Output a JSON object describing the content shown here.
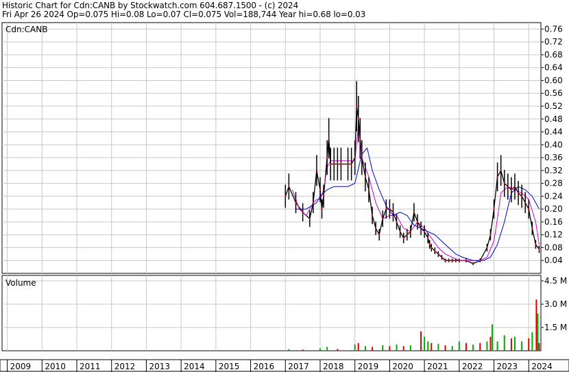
{
  "header": {
    "line1": "Historic Chart for Cdn:CANB by Stockwatch.com 604.687.1500 - (c) 2024",
    "line2": "Fri Apr 26 2024   Op=0.075   Hi=0.08   Lo=0.07   Cl=0.075   Vol=188,744   Year hi=0.68   lo=0.03"
  },
  "chart_data": [
    {
      "type": "line",
      "title": "Cdn:CANB",
      "ylim": [
        0,
        0.78
      ],
      "y_ticks": [
        "0.76",
        "0.72",
        "0.68",
        "0.64",
        "0.60",
        "0.56",
        "0.52",
        "0.48",
        "0.44",
        "0.40",
        "0.36",
        "0.32",
        "0.28",
        "0.24",
        "0.20",
        "0.16",
        "0.12",
        "0.08",
        "0.04"
      ],
      "x_labels": [
        "2009",
        "2010",
        "2011",
        "2012",
        "2013",
        "2014",
        "2015",
        "2016",
        "2017",
        "2018",
        "2019",
        "2020",
        "2021",
        "2022",
        "2023",
        "2024"
      ],
      "grid": true,
      "colors": {
        "price": "#000000",
        "ma_short": "#ff0000",
        "ma_mid": "#cc00cc",
        "ma_long": "#0000cc"
      },
      "series": [
        {
          "role": "price",
          "x": [
            2017.0,
            2017.1,
            2017.3,
            2017.5,
            2017.7,
            2017.8,
            2017.9,
            2018.0,
            2018.05,
            2018.1,
            2018.2,
            2018.25,
            2018.3,
            2018.4,
            2018.5,
            2018.6,
            2018.8,
            2018.9,
            2019.0,
            2019.05,
            2019.1,
            2019.15,
            2019.2,
            2019.3,
            2019.4,
            2019.5,
            2019.6,
            2019.7,
            2019.8,
            2019.9,
            2020.0,
            2020.1,
            2020.2,
            2020.3,
            2020.4,
            2020.5,
            2020.6,
            2020.7,
            2020.8,
            2020.9,
            2021.0,
            2021.1,
            2021.15,
            2021.2,
            2021.3,
            2021.4,
            2021.5,
            2021.6,
            2021.7,
            2021.8,
            2021.9,
            2022.0,
            2022.2,
            2022.4,
            2022.6,
            2022.8,
            2022.9,
            2023.0,
            2023.1,
            2023.2,
            2023.3,
            2023.4,
            2023.5,
            2023.6,
            2023.7,
            2023.8,
            2023.9,
            2024.0,
            2024.1,
            2024.2,
            2024.3
          ],
          "values": [
            0.24,
            0.27,
            0.22,
            0.19,
            0.17,
            0.22,
            0.32,
            0.26,
            0.2,
            0.24,
            0.36,
            0.42,
            0.34,
            0.34,
            0.34,
            0.34,
            0.34,
            0.34,
            0.36,
            0.52,
            0.48,
            0.42,
            0.36,
            0.3,
            0.26,
            0.18,
            0.14,
            0.12,
            0.17,
            0.2,
            0.2,
            0.19,
            0.16,
            0.13,
            0.11,
            0.12,
            0.13,
            0.19,
            0.16,
            0.14,
            0.13,
            0.11,
            0.09,
            0.08,
            0.07,
            0.06,
            0.05,
            0.04,
            0.04,
            0.04,
            0.04,
            0.04,
            0.04,
            0.03,
            0.04,
            0.08,
            0.12,
            0.2,
            0.3,
            0.32,
            0.28,
            0.27,
            0.26,
            0.27,
            0.25,
            0.24,
            0.22,
            0.2,
            0.14,
            0.09,
            0.075
          ]
        },
        {
          "role": "ma_mid",
          "x": [
            2017.2,
            2017.4,
            2017.6,
            2017.8,
            2017.9,
            2018.0,
            2018.1,
            2018.2,
            2018.3,
            2018.5,
            2018.7,
            2018.9,
            2019.0,
            2019.1,
            2019.2,
            2019.4,
            2019.6,
            2019.8,
            2020.0,
            2020.2,
            2020.4,
            2020.6,
            2020.8,
            2021.0,
            2021.2,
            2021.4,
            2021.6,
            2021.8,
            2022.0,
            2022.3,
            2022.6,
            2022.8,
            2023.0,
            2023.1,
            2023.2,
            2023.4,
            2023.6,
            2023.8,
            2024.0,
            2024.2,
            2024.3
          ],
          "values": [
            0.26,
            0.2,
            0.18,
            0.22,
            0.23,
            0.23,
            0.26,
            0.33,
            0.35,
            0.35,
            0.35,
            0.35,
            0.35,
            0.46,
            0.36,
            0.3,
            0.22,
            0.17,
            0.18,
            0.18,
            0.14,
            0.13,
            0.16,
            0.14,
            0.11,
            0.08,
            0.06,
            0.05,
            0.04,
            0.04,
            0.04,
            0.05,
            0.1,
            0.17,
            0.25,
            0.27,
            0.26,
            0.25,
            0.23,
            0.16,
            0.09
          ]
        },
        {
          "role": "ma_long",
          "x": [
            2017.3,
            2017.6,
            2017.9,
            2018.0,
            2018.2,
            2018.4,
            2018.6,
            2018.8,
            2019.0,
            2019.2,
            2019.35,
            2019.5,
            2019.7,
            2019.9,
            2020.1,
            2020.3,
            2020.5,
            2020.7,
            2020.9,
            2021.1,
            2021.3,
            2021.5,
            2021.7,
            2021.9,
            2022.1,
            2022.4,
            2022.7,
            2022.9,
            2023.1,
            2023.3,
            2023.5,
            2023.7,
            2023.9,
            2024.1,
            2024.3
          ],
          "values": [
            0.2,
            0.2,
            0.22,
            0.24,
            0.26,
            0.27,
            0.27,
            0.27,
            0.28,
            0.37,
            0.39,
            0.32,
            0.26,
            0.21,
            0.18,
            0.19,
            0.18,
            0.15,
            0.14,
            0.13,
            0.12,
            0.1,
            0.08,
            0.06,
            0.05,
            0.04,
            0.04,
            0.05,
            0.09,
            0.16,
            0.25,
            0.27,
            0.26,
            0.24,
            0.2
          ]
        }
      ]
    },
    {
      "type": "bar",
      "title": "Volume",
      "ylim": [
        0,
        4.5
      ],
      "y_ticks": [
        "4.5 M",
        "3.0 M",
        "1.5 M"
      ],
      "x_labels": [
        "2009",
        "2010",
        "2011",
        "2012",
        "2013",
        "2014",
        "2015",
        "2016",
        "2017",
        "2018",
        "2019",
        "2020",
        "2021",
        "2022",
        "2023",
        "2024"
      ],
      "grid": true,
      "colors": {
        "up": "#00aa00",
        "down": "#dd0000"
      },
      "bars": [
        {
          "x": 2017.1,
          "v": 0.1,
          "d": "up"
        },
        {
          "x": 2017.5,
          "v": 0.08,
          "d": "down"
        },
        {
          "x": 2018.0,
          "v": 0.15,
          "d": "up"
        },
        {
          "x": 2018.2,
          "v": 0.25,
          "d": "up"
        },
        {
          "x": 2018.5,
          "v": 0.12,
          "d": "down"
        },
        {
          "x": 2019.0,
          "v": 0.4,
          "d": "up"
        },
        {
          "x": 2019.1,
          "v": 0.5,
          "d": "down"
        },
        {
          "x": 2019.3,
          "v": 0.3,
          "d": "up"
        },
        {
          "x": 2019.5,
          "v": 0.25,
          "d": "down"
        },
        {
          "x": 2019.8,
          "v": 0.35,
          "d": "up"
        },
        {
          "x": 2020.0,
          "v": 0.3,
          "d": "down"
        },
        {
          "x": 2020.2,
          "v": 0.4,
          "d": "up"
        },
        {
          "x": 2020.4,
          "v": 0.3,
          "d": "down"
        },
        {
          "x": 2020.6,
          "v": 0.35,
          "d": "up"
        },
        {
          "x": 2020.9,
          "v": 1.25,
          "d": "down"
        },
        {
          "x": 2021.0,
          "v": 0.9,
          "d": "up"
        },
        {
          "x": 2021.1,
          "v": 0.6,
          "d": "up"
        },
        {
          "x": 2021.2,
          "v": 0.5,
          "d": "down"
        },
        {
          "x": 2021.4,
          "v": 0.45,
          "d": "up"
        },
        {
          "x": 2021.6,
          "v": 0.35,
          "d": "down"
        },
        {
          "x": 2021.8,
          "v": 0.3,
          "d": "up"
        },
        {
          "x": 2022.0,
          "v": 0.6,
          "d": "up"
        },
        {
          "x": 2022.2,
          "v": 0.5,
          "d": "down"
        },
        {
          "x": 2022.4,
          "v": 0.4,
          "d": "up"
        },
        {
          "x": 2022.6,
          "v": 0.5,
          "d": "down"
        },
        {
          "x": 2022.8,
          "v": 0.6,
          "d": "up"
        },
        {
          "x": 2022.9,
          "v": 0.9,
          "d": "down"
        },
        {
          "x": 2022.95,
          "v": 1.7,
          "d": "up"
        },
        {
          "x": 2023.1,
          "v": 0.6,
          "d": "up"
        },
        {
          "x": 2023.3,
          "v": 1.0,
          "d": "up"
        },
        {
          "x": 2023.5,
          "v": 0.8,
          "d": "down"
        },
        {
          "x": 2023.6,
          "v": 0.9,
          "d": "up"
        },
        {
          "x": 2023.8,
          "v": 0.6,
          "d": "up"
        },
        {
          "x": 2024.0,
          "v": 0.8,
          "d": "down"
        },
        {
          "x": 2024.1,
          "v": 1.2,
          "d": "up"
        },
        {
          "x": 2024.22,
          "v": 3.3,
          "d": "down"
        },
        {
          "x": 2024.26,
          "v": 2.4,
          "d": "up"
        },
        {
          "x": 2024.3,
          "v": 0.5,
          "d": "down"
        }
      ]
    }
  ]
}
